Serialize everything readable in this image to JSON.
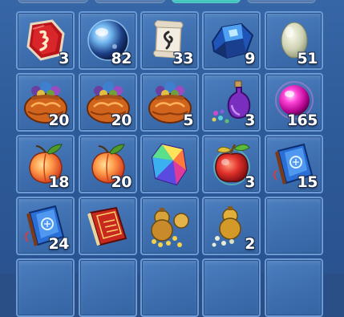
{
  "inventory": {
    "tabs": [
      {
        "id": "tab-1",
        "active": false
      },
      {
        "id": "tab-2",
        "active": false
      },
      {
        "id": "tab-3",
        "active": true
      },
      {
        "id": "tab-4",
        "active": false
      }
    ],
    "rows": [
      [
        {
          "icon": "red-rune-stone-icon",
          "count": "3"
        },
        {
          "icon": "crystal-orb-icon",
          "count": "82"
        },
        {
          "icon": "rune-scroll-icon",
          "count": "33"
        },
        {
          "icon": "blue-ore-icon",
          "count": "9"
        },
        {
          "icon": "pale-stone-egg-icon",
          "count": "51"
        }
      ],
      [
        {
          "icon": "treasure-bag-icon",
          "count": "20"
        },
        {
          "icon": "treasure-bag-icon",
          "count": "20"
        },
        {
          "icon": "treasure-bag-icon",
          "count": "5"
        },
        {
          "icon": "purple-potion-icon",
          "count": "3"
        },
        {
          "icon": "magenta-pearl-icon",
          "count": "165"
        }
      ],
      [
        {
          "icon": "peach-fruit-icon",
          "count": "18"
        },
        {
          "icon": "peach-fruit-icon",
          "count": "20"
        },
        {
          "icon": "rainbow-gem-icon",
          "count": ""
        },
        {
          "icon": "magic-apple-icon",
          "count": "3"
        },
        {
          "icon": "blue-spellbook-icon",
          "count": "15"
        }
      ],
      [
        {
          "icon": "blue-spellbook-icon",
          "count": "24"
        },
        {
          "icon": "red-book-icon",
          "count": ""
        },
        {
          "icon": "golden-gourd-beads-icon",
          "count": ""
        },
        {
          "icon": "golden-gourd-pearls-icon",
          "count": "2"
        },
        {
          "icon": "empty-slot",
          "count": ""
        }
      ],
      [
        {
          "icon": "empty-slot",
          "count": ""
        },
        {
          "icon": "empty-slot",
          "count": ""
        },
        {
          "icon": "empty-slot",
          "count": ""
        },
        {
          "icon": "empty-slot",
          "count": ""
        },
        {
          "icon": "empty-slot",
          "count": ""
        }
      ]
    ]
  }
}
